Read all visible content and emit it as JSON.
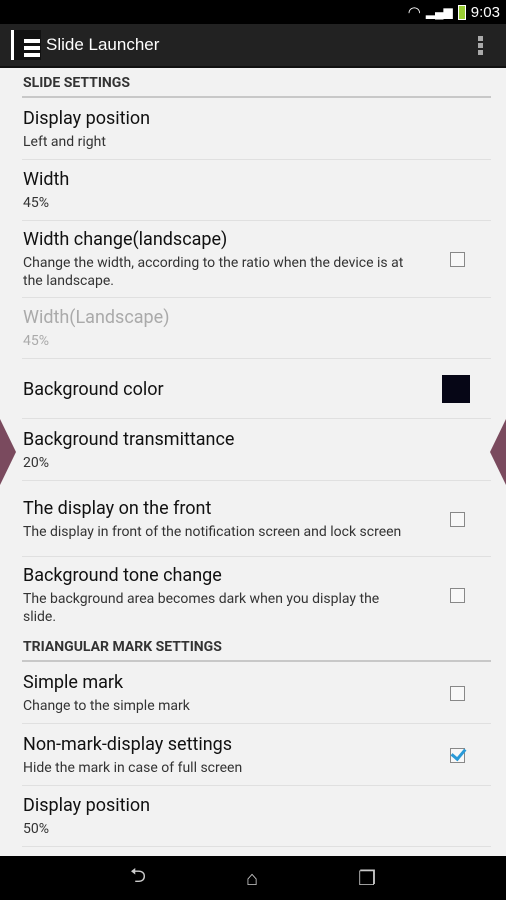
{
  "status": {
    "time": "9:03",
    "icons": [
      "wifi-icon",
      "signal-icon",
      "battery-icon"
    ]
  },
  "app": {
    "title": "Slide Launcher",
    "icon_label": "Launcher"
  },
  "sections": [
    {
      "header": "SLIDE SETTINGS",
      "items": [
        {
          "title": "Display position",
          "summary": "Left and right"
        },
        {
          "title": "Width",
          "summary": "45%"
        },
        {
          "title": "Width change(landscape)",
          "summary": "Change the width, according to the ratio when the device is at the landscape.",
          "checked": false
        },
        {
          "title": "Width(Landscape)",
          "summary": "45%",
          "disabled": true
        },
        {
          "title": "Background color",
          "color": "#060616"
        },
        {
          "title": "Background transmittance",
          "summary": "20%"
        },
        {
          "title": "The display on the front",
          "summary": "The display in front of the notification screen and lock screen",
          "checked": false
        },
        {
          "title": "Background tone change",
          "summary": "The background area becomes dark when you display the slide.",
          "checked": false
        }
      ]
    },
    {
      "header": "TRIANGULAR MARK SETTINGS",
      "items": [
        {
          "title": "Simple mark",
          "summary": "Change to the simple mark",
          "checked": false
        },
        {
          "title": "Non-mark-display settings",
          "summary": "Hide the mark in case of full screen",
          "checked": true
        },
        {
          "title": "Display position",
          "summary": "50%"
        }
      ]
    }
  ],
  "colors": {
    "accent": "#2a9ad8",
    "mark": "#7a4a5e"
  },
  "nav": [
    "back-icon",
    "home-icon",
    "recents-icon"
  ]
}
